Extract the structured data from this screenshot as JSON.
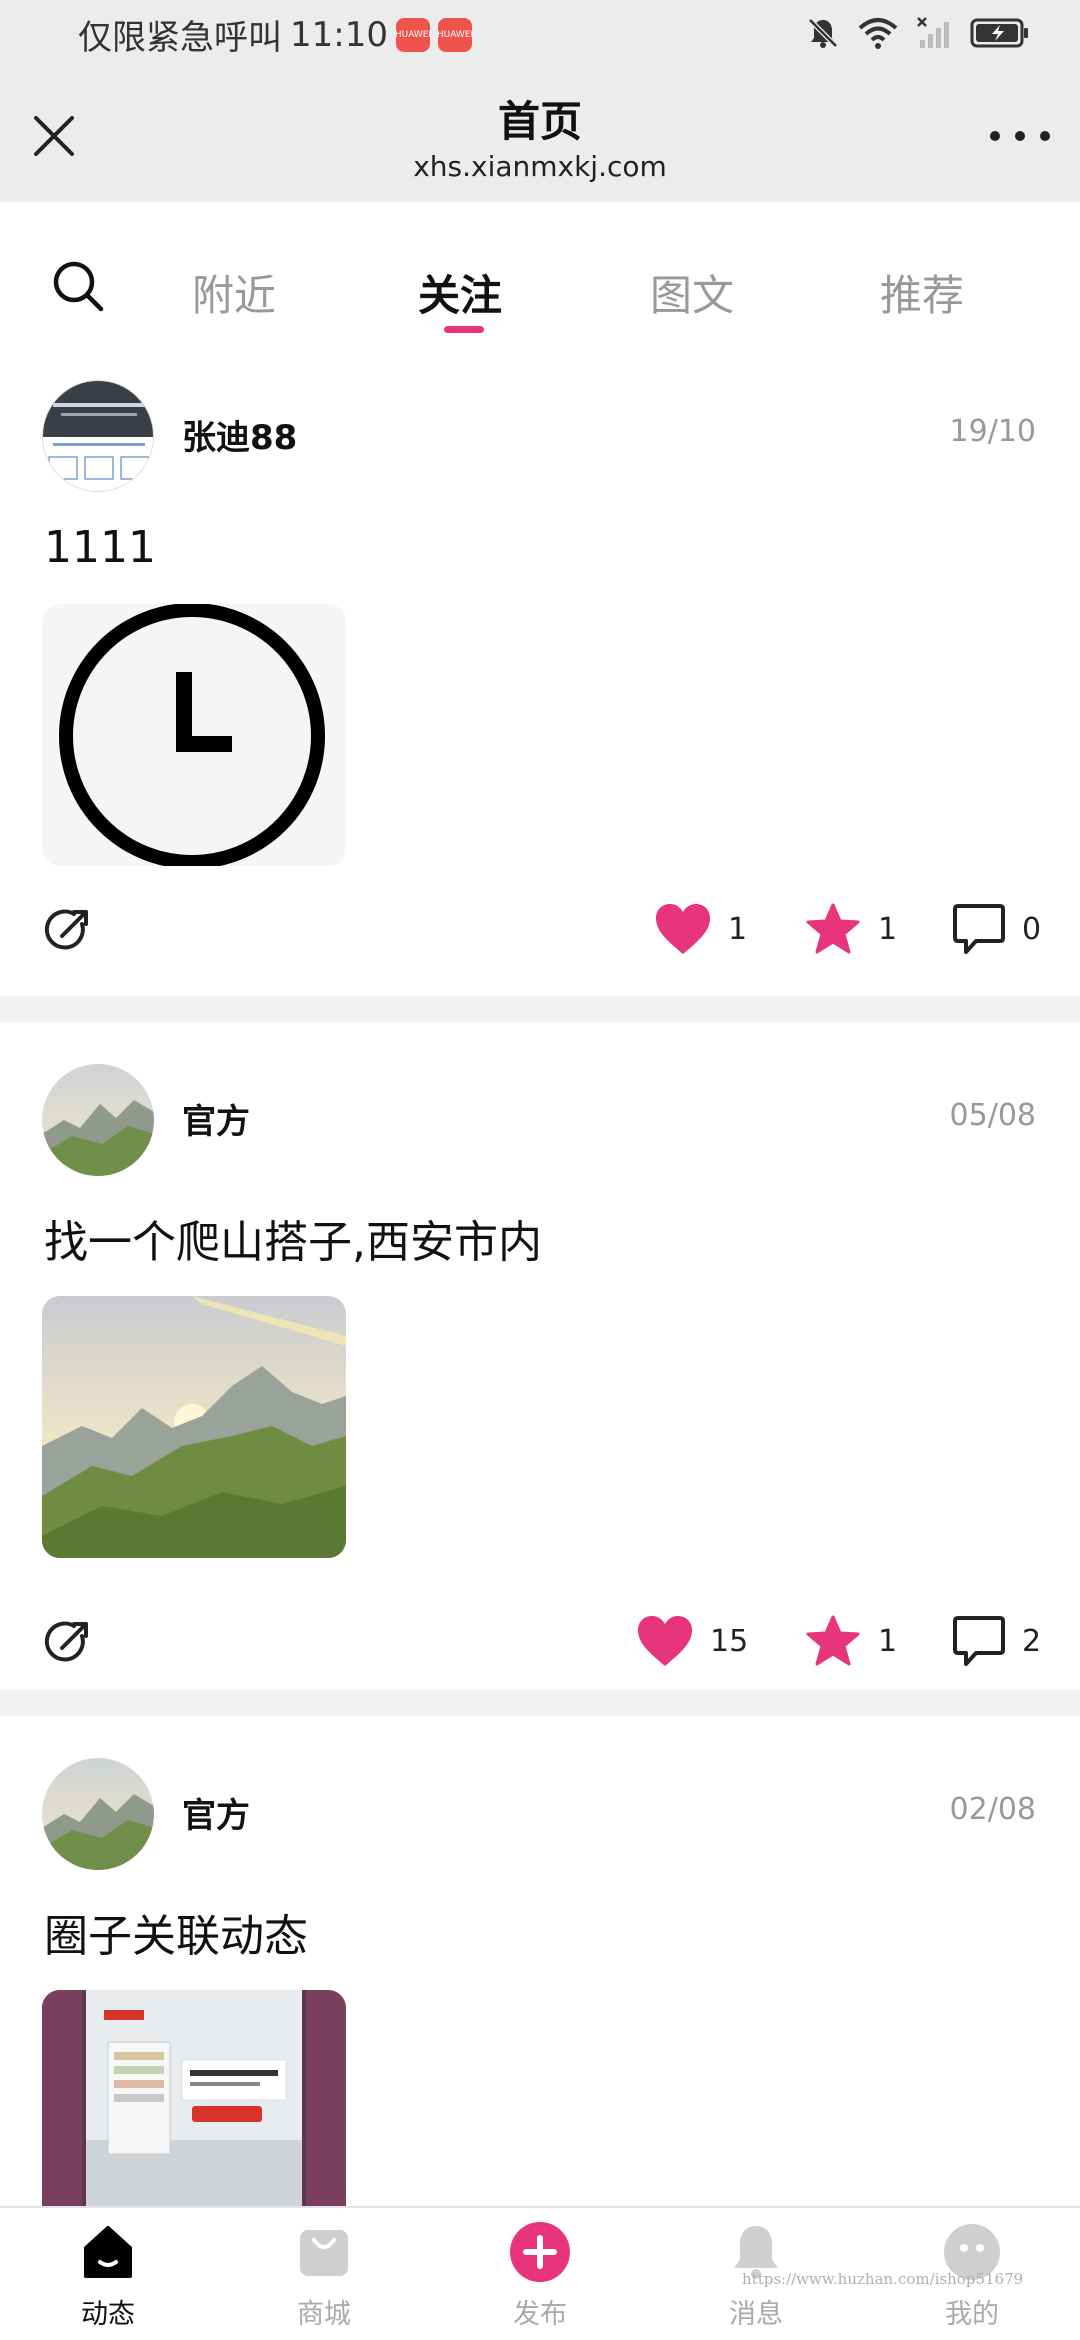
{
  "status_bar": {
    "carrier_text": "仅限紧急呼叫",
    "time": "11:10",
    "notifications": [
      "HUAWEI",
      "HUAWEI"
    ],
    "icons": [
      "mute-bell-icon",
      "wifi-icon",
      "no-signal-icon",
      "battery-charging-icon"
    ]
  },
  "nav": {
    "title": "首页",
    "url": "xhs.xianmxkj.com",
    "close_icon": "close-icon",
    "more_icon": "more-dots-icon"
  },
  "tabs": {
    "search_icon": "search-icon",
    "items": [
      {
        "label": "附近"
      },
      {
        "label": "关注"
      },
      {
        "label": "图文"
      },
      {
        "label": "推荐"
      }
    ],
    "active": "关注",
    "accent": "#e8347a"
  },
  "posts": [
    {
      "username": "张迪88",
      "date": "19/10",
      "text": "1111",
      "image": "clock-image",
      "likes": "1",
      "stars": "1",
      "comments": "0"
    },
    {
      "username": "官方",
      "date": "05/08",
      "text": "找一个爬山搭子,西安市内",
      "image": "mountain-landscape",
      "likes": "15",
      "stars": "1",
      "comments": "2"
    },
    {
      "username": "官方",
      "date": "02/08",
      "text": "圈子关联动态",
      "image": "product-promo-image"
    }
  ],
  "tabbar": {
    "items": [
      {
        "label": "动态",
        "icon": "home-icon"
      },
      {
        "label": "商城",
        "icon": "shopping-bag-icon"
      },
      {
        "label": "发布",
        "icon": "publish-plus-icon"
      },
      {
        "label": "消息",
        "icon": "bell-icon"
      },
      {
        "label": "我的",
        "icon": "profile-icon"
      }
    ],
    "active": "动态"
  },
  "watermark": "https://www.huzhan.com/ishop51679",
  "colors": {
    "accent": "#e8347a",
    "header_bg": "#ececec",
    "separator": "#f2f2f2"
  }
}
